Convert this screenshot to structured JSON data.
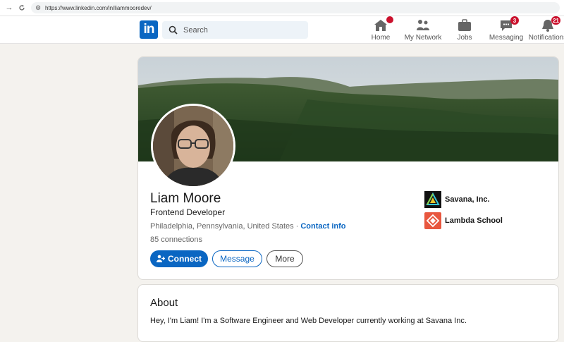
{
  "browser": {
    "url": "https://www.linkedin.com/in/liammooredev/"
  },
  "nav": {
    "logo": "in",
    "search_placeholder": "Search",
    "items": [
      {
        "label": "Home",
        "icon": "home-icon",
        "badge": ""
      },
      {
        "label": "My Network",
        "icon": "people-icon",
        "badge": null
      },
      {
        "label": "Jobs",
        "icon": "briefcase-icon",
        "badge": null
      },
      {
        "label": "Messaging",
        "icon": "chat-icon",
        "badge": "3"
      },
      {
        "label": "Notifications",
        "icon": "bell-icon",
        "badge": "21"
      }
    ]
  },
  "profile": {
    "name": "Liam Moore",
    "headline": "Frontend Developer",
    "location": "Philadelphia, Pennsylvania, United States",
    "separator": "·",
    "contact_label": "Contact info",
    "connections": "85 connections",
    "buttons": {
      "connect": "Connect",
      "message": "Message",
      "more": "More"
    },
    "orgs": [
      {
        "name": "Savana, Inc.",
        "icon": "savana-logo"
      },
      {
        "name": "Lambda School",
        "icon": "lambda-school-logo"
      }
    ]
  },
  "about": {
    "title": "About",
    "text": "Hey, I'm Liam! I'm a Software Engineer and Web Developer currently working at Savana Inc."
  },
  "colors": {
    "brand": "#0a66c2",
    "badge": "#cb112d",
    "page_bg": "#f4f2ee"
  }
}
